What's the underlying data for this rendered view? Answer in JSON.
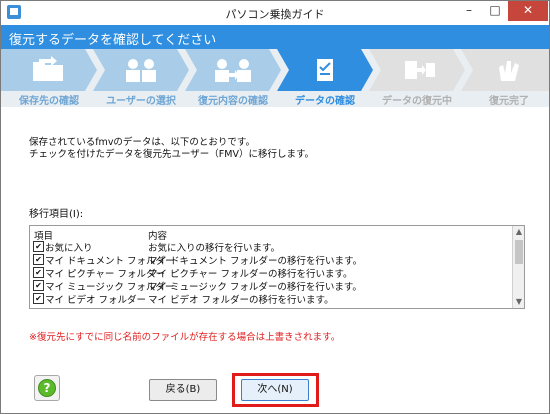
{
  "window": {
    "title": "パソコン乗換ガイド",
    "min_icon": "–",
    "max_icon": "□",
    "close_icon": "✕"
  },
  "header": {
    "title": "復元するデータを確認してください",
    "color": "#2f8ee0"
  },
  "steps": [
    {
      "label": "保存先の確認",
      "state": "done",
      "icon": "folder-arrow-icon"
    },
    {
      "label": "ユーザーの選択",
      "state": "done",
      "icon": "users-icon"
    },
    {
      "label": "復元内容の確認",
      "state": "done",
      "icon": "user-transfer-icon"
    },
    {
      "label": "データの確認",
      "state": "current",
      "icon": "document-check-icon"
    },
    {
      "label": "データの復元中",
      "state": "pending",
      "icon": "copy-icon"
    },
    {
      "label": "復元完了",
      "state": "pending",
      "icon": "clap-icon"
    }
  ],
  "intro": {
    "line1": "保存されているfmvのデータは、以下のとおりです。",
    "line2": "チェックを付けたデータを復元先ユーザー（FMV）に移行します。"
  },
  "list": {
    "label": "移行項目(I):",
    "headers": [
      "項目",
      "内容"
    ],
    "rows": [
      {
        "checked": true,
        "item": "お気に入り",
        "desc": "お気に入りの移行を行います。"
      },
      {
        "checked": true,
        "item": "マイ ドキュメント フォルダー",
        "desc": "マイ ドキュメント フォルダーの移行を行います。"
      },
      {
        "checked": true,
        "item": "マイ ピクチャー フォルダー",
        "desc": "マイ ピクチャー フォルダーの移行を行います。"
      },
      {
        "checked": true,
        "item": "マイ ミュージック フォルダー",
        "desc": "マイ ミュージック フォルダーの移行を行います。"
      },
      {
        "checked": true,
        "item": "マイ ビデオ フォルダー",
        "desc": "マイ ビデオ フォルダーの移行を行います。"
      }
    ]
  },
  "warning": "※復元先にすでに同じ名前のファイルが存在する場合は上書きされます。",
  "buttons": {
    "help": "?",
    "back": "戻る(B)",
    "next": "次へ(N)"
  },
  "colors": {
    "done_step": "#a9cde9",
    "current_step": "#2f8ee0",
    "pending_step": "#e0e0e0",
    "warning": "#e02020",
    "highlight": "#e11a1a"
  }
}
